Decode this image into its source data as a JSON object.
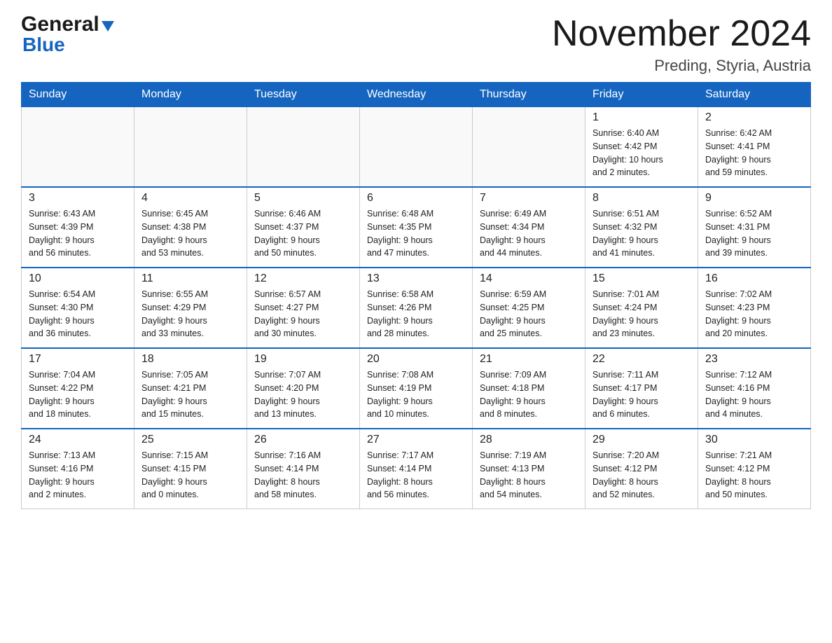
{
  "header": {
    "logo_general": "General",
    "logo_blue": "Blue",
    "month_title": "November 2024",
    "location": "Preding, Styria, Austria"
  },
  "weekdays": [
    "Sunday",
    "Monday",
    "Tuesday",
    "Wednesday",
    "Thursday",
    "Friday",
    "Saturday"
  ],
  "weeks": [
    [
      {
        "day": "",
        "info": ""
      },
      {
        "day": "",
        "info": ""
      },
      {
        "day": "",
        "info": ""
      },
      {
        "day": "",
        "info": ""
      },
      {
        "day": "",
        "info": ""
      },
      {
        "day": "1",
        "info": "Sunrise: 6:40 AM\nSunset: 4:42 PM\nDaylight: 10 hours\nand 2 minutes."
      },
      {
        "day": "2",
        "info": "Sunrise: 6:42 AM\nSunset: 4:41 PM\nDaylight: 9 hours\nand 59 minutes."
      }
    ],
    [
      {
        "day": "3",
        "info": "Sunrise: 6:43 AM\nSunset: 4:39 PM\nDaylight: 9 hours\nand 56 minutes."
      },
      {
        "day": "4",
        "info": "Sunrise: 6:45 AM\nSunset: 4:38 PM\nDaylight: 9 hours\nand 53 minutes."
      },
      {
        "day": "5",
        "info": "Sunrise: 6:46 AM\nSunset: 4:37 PM\nDaylight: 9 hours\nand 50 minutes."
      },
      {
        "day": "6",
        "info": "Sunrise: 6:48 AM\nSunset: 4:35 PM\nDaylight: 9 hours\nand 47 minutes."
      },
      {
        "day": "7",
        "info": "Sunrise: 6:49 AM\nSunset: 4:34 PM\nDaylight: 9 hours\nand 44 minutes."
      },
      {
        "day": "8",
        "info": "Sunrise: 6:51 AM\nSunset: 4:32 PM\nDaylight: 9 hours\nand 41 minutes."
      },
      {
        "day": "9",
        "info": "Sunrise: 6:52 AM\nSunset: 4:31 PM\nDaylight: 9 hours\nand 39 minutes."
      }
    ],
    [
      {
        "day": "10",
        "info": "Sunrise: 6:54 AM\nSunset: 4:30 PM\nDaylight: 9 hours\nand 36 minutes."
      },
      {
        "day": "11",
        "info": "Sunrise: 6:55 AM\nSunset: 4:29 PM\nDaylight: 9 hours\nand 33 minutes."
      },
      {
        "day": "12",
        "info": "Sunrise: 6:57 AM\nSunset: 4:27 PM\nDaylight: 9 hours\nand 30 minutes."
      },
      {
        "day": "13",
        "info": "Sunrise: 6:58 AM\nSunset: 4:26 PM\nDaylight: 9 hours\nand 28 minutes."
      },
      {
        "day": "14",
        "info": "Sunrise: 6:59 AM\nSunset: 4:25 PM\nDaylight: 9 hours\nand 25 minutes."
      },
      {
        "day": "15",
        "info": "Sunrise: 7:01 AM\nSunset: 4:24 PM\nDaylight: 9 hours\nand 23 minutes."
      },
      {
        "day": "16",
        "info": "Sunrise: 7:02 AM\nSunset: 4:23 PM\nDaylight: 9 hours\nand 20 minutes."
      }
    ],
    [
      {
        "day": "17",
        "info": "Sunrise: 7:04 AM\nSunset: 4:22 PM\nDaylight: 9 hours\nand 18 minutes."
      },
      {
        "day": "18",
        "info": "Sunrise: 7:05 AM\nSunset: 4:21 PM\nDaylight: 9 hours\nand 15 minutes."
      },
      {
        "day": "19",
        "info": "Sunrise: 7:07 AM\nSunset: 4:20 PM\nDaylight: 9 hours\nand 13 minutes."
      },
      {
        "day": "20",
        "info": "Sunrise: 7:08 AM\nSunset: 4:19 PM\nDaylight: 9 hours\nand 10 minutes."
      },
      {
        "day": "21",
        "info": "Sunrise: 7:09 AM\nSunset: 4:18 PM\nDaylight: 9 hours\nand 8 minutes."
      },
      {
        "day": "22",
        "info": "Sunrise: 7:11 AM\nSunset: 4:17 PM\nDaylight: 9 hours\nand 6 minutes."
      },
      {
        "day": "23",
        "info": "Sunrise: 7:12 AM\nSunset: 4:16 PM\nDaylight: 9 hours\nand 4 minutes."
      }
    ],
    [
      {
        "day": "24",
        "info": "Sunrise: 7:13 AM\nSunset: 4:16 PM\nDaylight: 9 hours\nand 2 minutes."
      },
      {
        "day": "25",
        "info": "Sunrise: 7:15 AM\nSunset: 4:15 PM\nDaylight: 9 hours\nand 0 minutes."
      },
      {
        "day": "26",
        "info": "Sunrise: 7:16 AM\nSunset: 4:14 PM\nDaylight: 8 hours\nand 58 minutes."
      },
      {
        "day": "27",
        "info": "Sunrise: 7:17 AM\nSunset: 4:14 PM\nDaylight: 8 hours\nand 56 minutes."
      },
      {
        "day": "28",
        "info": "Sunrise: 7:19 AM\nSunset: 4:13 PM\nDaylight: 8 hours\nand 54 minutes."
      },
      {
        "day": "29",
        "info": "Sunrise: 7:20 AM\nSunset: 4:12 PM\nDaylight: 8 hours\nand 52 minutes."
      },
      {
        "day": "30",
        "info": "Sunrise: 7:21 AM\nSunset: 4:12 PM\nDaylight: 8 hours\nand 50 minutes."
      }
    ]
  ]
}
